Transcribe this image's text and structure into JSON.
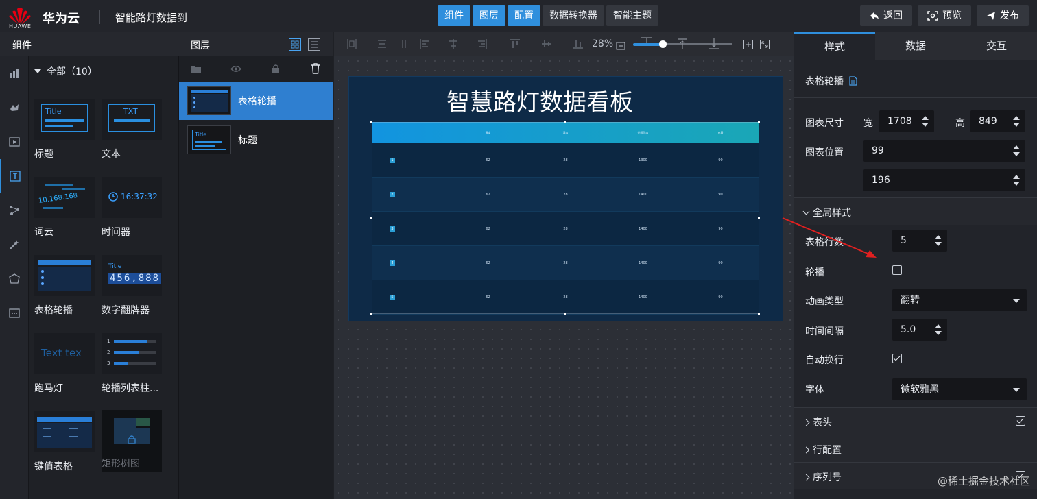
{
  "header": {
    "logo_text": "HUAWEI",
    "brand": "华为云",
    "project_name": "智能路灯数据到",
    "tabs": [
      {
        "label": "组件",
        "active": true
      },
      {
        "label": "图层",
        "active": true
      },
      {
        "label": "配置",
        "active": true
      },
      {
        "label": "数据转换器",
        "active": false
      },
      {
        "label": "智能主题",
        "active": false
      }
    ],
    "actions": {
      "back": "返回",
      "preview": "预览",
      "publish": "发布"
    }
  },
  "components": {
    "title": "组件",
    "all_label": "全部（10）",
    "items": [
      {
        "label": "标题",
        "thumb": "Title"
      },
      {
        "label": "文本",
        "thumb": "TXT"
      },
      {
        "label": "词云",
        "thumb": "10.168.168"
      },
      {
        "label": "时间器",
        "thumb": "16:37:32"
      },
      {
        "label": "表格轮播",
        "thumb": ""
      },
      {
        "label": "数字翻牌器",
        "thumb": "456,888"
      },
      {
        "label": "跑马灯",
        "thumb": "Text tex"
      },
      {
        "label": "轮播列表柱...",
        "thumb": ""
      },
      {
        "label": "键值表格",
        "thumb": ""
      },
      {
        "label": "矩形树图",
        "thumb": ""
      }
    ]
  },
  "layers": {
    "title": "图层",
    "items": [
      {
        "label": "表格轮播",
        "active": true
      },
      {
        "label": "标题",
        "active": false
      }
    ]
  },
  "toolbar": {
    "zoom": "28%"
  },
  "canvas": {
    "title": "智慧路灯数据看板",
    "table": {
      "headers": [
        "",
        "温度",
        "湿度",
        "光照强度",
        "电量"
      ],
      "rows": [
        [
          "1",
          "62",
          "28",
          "1300",
          "90"
        ],
        [
          "2",
          "62",
          "28",
          "1400",
          "90"
        ],
        [
          "3",
          "62",
          "28",
          "1400",
          "90"
        ],
        [
          "4",
          "62",
          "28",
          "1400",
          "90"
        ],
        [
          "5",
          "62",
          "28",
          "1400",
          "90"
        ]
      ]
    }
  },
  "properties": {
    "tabs": [
      "样式",
      "数据",
      "交互"
    ],
    "component_name": "表格轮播",
    "size_label": "图表尺寸",
    "width_label": "宽",
    "width": "1708",
    "height_label": "高",
    "height": "849",
    "position_label": "图表位置",
    "pos_x": "99",
    "pos_y": "196",
    "global_section": "全局样式",
    "rows_label": "表格行数",
    "rows": "5",
    "carousel_label": "轮播",
    "anim_label": "动画类型",
    "anim_value": "翻转",
    "interval_label": "时间间隔",
    "interval_value": "5.0",
    "wrap_label": "自动换行",
    "font_label": "字体",
    "font_value": "微软雅黑",
    "header_section": "表头",
    "row_config_section": "行配置",
    "index_section": "序列号"
  },
  "watermark": "@稀土掘金技术社区",
  "colors": {
    "accent": "#2f8fdd",
    "panel": "#22242a",
    "screen": "#0e2a47"
  }
}
